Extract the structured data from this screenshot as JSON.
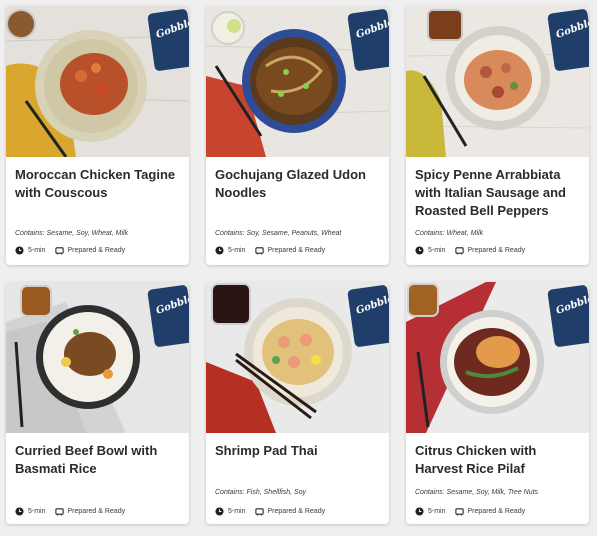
{
  "brand": "Gobble",
  "colors": {
    "card_bg": "#ffffff",
    "page_bg": "#efefef",
    "title": "#2b2b2b",
    "box_blue": "#1f3f6a"
  },
  "meals": [
    {
      "title": "Moroccan Chicken Tagine with Couscous",
      "contains": "Contains: Sesame, Soy, Wheat, Milk",
      "time": "5-min",
      "status": "Prepared & Ready",
      "icons": [
        "clock-icon",
        "pan-icon"
      ]
    },
    {
      "title": "Gochujang Glazed Udon Noodles",
      "contains": "Contains: Soy, Sesame, Peanuts, Wheat",
      "time": "5-min",
      "status": "Prepared & Ready",
      "icons": [
        "clock-icon",
        "pan-icon"
      ]
    },
    {
      "title": "Spicy Penne Arrabbiata with Italian Sausage and Roasted Bell Peppers",
      "contains": "Contains: Wheat, Milk",
      "time": "5-min",
      "status": "Prepared & Ready",
      "icons": [
        "clock-icon",
        "pan-icon"
      ]
    },
    {
      "title": "Curried Beef Bowl with Basmati Rice",
      "contains": "",
      "time": "5-min",
      "status": "Prepared & Ready",
      "icons": [
        "clock-icon",
        "pan-icon"
      ]
    },
    {
      "title": "Shrimp Pad Thai",
      "contains": "Contains: Fish, Shellfish, Soy",
      "time": "5-min",
      "status": "Prepared & Ready",
      "icons": [
        "clock-icon",
        "pan-icon"
      ]
    },
    {
      "title": "Citrus Chicken with Harvest Rice Pilaf",
      "contains": "Contains: Sesame, Soy, Milk, Tree Nuts",
      "time": "5-min",
      "status": "Prepared & Ready",
      "icons": [
        "clock-icon",
        "pan-icon"
      ]
    }
  ]
}
